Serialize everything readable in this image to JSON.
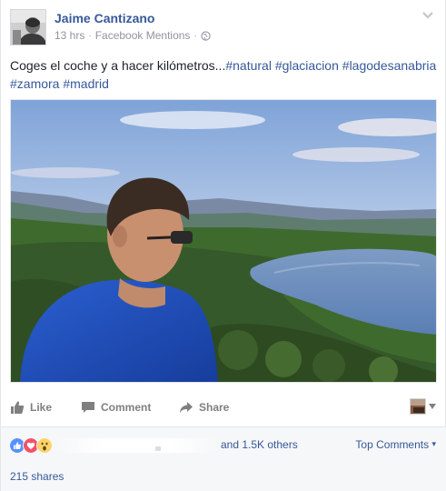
{
  "post": {
    "author": "Jaime Cantizano",
    "time": "13 hrs",
    "separator": "·",
    "source": "Facebook Mentions",
    "text": "Coges el coche y a hacer kilómetros...",
    "hashtags": [
      "#natural",
      "#glaciacion",
      "#lagodesanabria",
      "#zamora",
      "#madrid"
    ],
    "privacy_icon": "globe-icon"
  },
  "actions": {
    "like": "Like",
    "comment": "Comment",
    "share": "Share"
  },
  "reactions": {
    "types": [
      "like",
      "love",
      "wow"
    ],
    "others_text": "and 1.5K others",
    "sort_label": "Top Comments",
    "sort_caret": "▾"
  },
  "shares": {
    "text": "215 shares"
  },
  "colors": {
    "link": "#365899",
    "muted": "#90949c",
    "bar_bg": "#f6f7f9",
    "like_blue": "#5890ff",
    "love_red": "#f25268",
    "wow_yellow": "#fcd36a"
  }
}
